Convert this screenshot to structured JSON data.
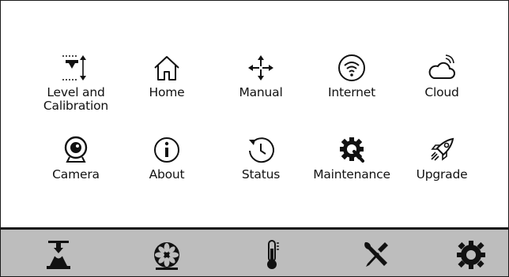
{
  "menu": {
    "items": [
      {
        "label": "Level and\nCalibration",
        "icon": "level-calibration-icon"
      },
      {
        "label": "Home",
        "icon": "house-icon"
      },
      {
        "label": "Manual",
        "icon": "move-arrows-icon"
      },
      {
        "label": "Internet",
        "icon": "wifi-icon"
      },
      {
        "label": "Cloud",
        "icon": "cloud-icon"
      },
      {
        "label": "Camera",
        "icon": "webcam-icon"
      },
      {
        "label": "About",
        "icon": "info-icon"
      },
      {
        "label": "Status",
        "icon": "history-clock-icon"
      },
      {
        "label": "Maintenance",
        "icon": "gear-wrench-icon"
      },
      {
        "label": "Upgrade",
        "icon": "rocket-icon"
      }
    ]
  },
  "bottom_bar": {
    "items": [
      {
        "icon": "printer-nozzle-icon"
      },
      {
        "icon": "fan-icon"
      },
      {
        "icon": "thermometer-icon"
      },
      {
        "icon": "tools-icon"
      },
      {
        "icon": "settings-gear-icon"
      }
    ]
  },
  "colors": {
    "bar_background": "#bdbdbd",
    "icon_color": "#111111"
  }
}
